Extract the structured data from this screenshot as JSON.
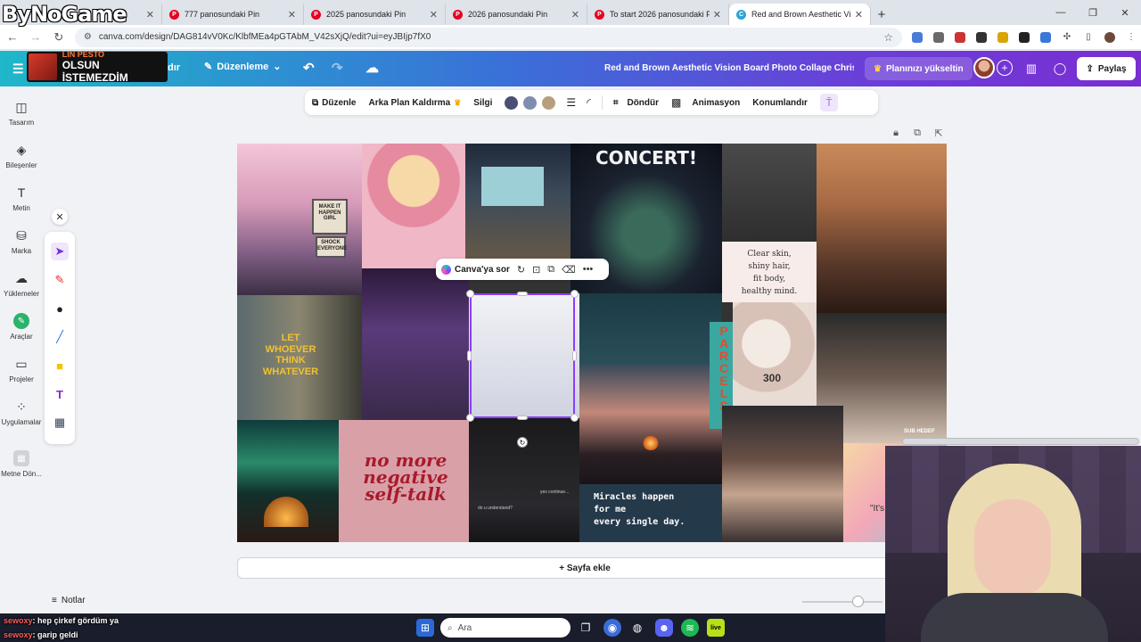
{
  "overlay": {
    "logo_text": "ByNoGame",
    "stream_line1": "LIN PESTO",
    "stream_line2": "OLSUN İSTEMEZDİM",
    "sub_goal": "SUB HEDEF"
  },
  "browser": {
    "tabs": [
      {
        "label": "777 panosundaki Pin",
        "icon": "pinterest"
      },
      {
        "label": "2025 panosundaki Pin",
        "icon": "pinterest"
      },
      {
        "label": "2026 panosundaki Pin",
        "icon": "pinterest"
      },
      {
        "label": "To start 2026 panosundaki Pin",
        "icon": "pinterest"
      },
      {
        "label": "Red and Brown Aesthetic Vision",
        "icon": "canva",
        "active": true
      }
    ],
    "url": "canva.com/design/DAG814vV0Kc/KlbfMEa4pGTAbM_V42sXjQ/edit?ui=eyJBIjp7fX0"
  },
  "header": {
    "file_partial": "dır",
    "edit_label": "Düzenleme",
    "title": "Red and Brown Aesthetic Vision Board Photo Collage Christ...",
    "upgrade_label": "Planınızı yükseltin",
    "share_label": "Paylaş"
  },
  "sidebar": {
    "items": [
      {
        "label": "Tasarım",
        "icon": "layout-icon"
      },
      {
        "label": "Bileşenler",
        "icon": "shapes-icon"
      },
      {
        "label": "Metin",
        "icon": "text-icon"
      },
      {
        "label": "Marka",
        "icon": "brand-icon"
      },
      {
        "label": "Yüklemeler",
        "icon": "upload-icon"
      },
      {
        "label": "Araçlar",
        "icon": "tools-icon"
      },
      {
        "label": "Projeler",
        "icon": "folder-icon"
      },
      {
        "label": "Uygulamalar",
        "icon": "apps-icon"
      },
      {
        "label": "Metne Dön...",
        "icon": "convert-icon"
      }
    ]
  },
  "toolbar": {
    "edit": "Düzenle",
    "bg_remove": "Arka Plan Kaldırma",
    "eraser": "Silgi",
    "colors": [
      "#4a4f73",
      "#7f8db0",
      "#b79e7c"
    ],
    "rotate": "Döndür",
    "animate": "Animasyon",
    "position": "Konumlandır"
  },
  "float_menu": {
    "ask": "Canva'ya sor"
  },
  "collage": {
    "sign_text1": "MAKE IT HAPPEN GIRL",
    "sign_text2": "SHOCK EVERYONE",
    "concert": "CONCERT!",
    "clear_skin": "Clear skin,\nshiny hair,\nfit body,\nhealthy mind.",
    "let_whoever": "LET\nWHOEVER\nTHINK\nWHATEVER",
    "parcels": "PARCELS",
    "no_more": "no more\nnegative\nself-talk",
    "do_u": "do u understand?",
    "yes_continue": "yes continue...",
    "miracles": "Miracles happen\nfor me\nevery single day.",
    "cookie": "300",
    "its": "\"It's"
  },
  "add_page": "+ Sayfa ekle",
  "notes": "Notlar",
  "chat": [
    {
      "user": "sewoxy",
      "text": ": hep çirkef gördüm ya"
    },
    {
      "user": "sewoxy",
      "text": ": garip geldi"
    }
  ],
  "taskbar": {
    "search_placeholder": "Ara"
  }
}
